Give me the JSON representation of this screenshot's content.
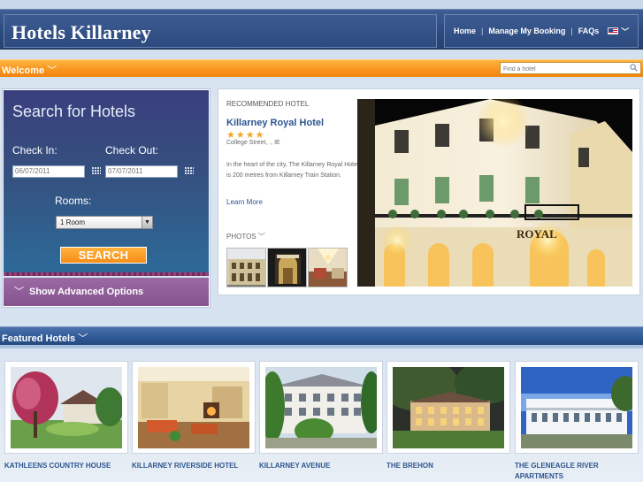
{
  "header": {
    "brand": "Hotels Killarney",
    "nav": [
      {
        "label": "Home"
      },
      {
        "label": "Manage My Booking"
      },
      {
        "label": "FAQs"
      }
    ]
  },
  "welcome_bar": {
    "label": "Welcome",
    "search_placeholder": "Find a hotel"
  },
  "search": {
    "title": "Search for Hotels",
    "checkin_label": "Check In:",
    "checkin_value": "06/07/2011",
    "checkout_label": "Check Out:",
    "checkout_value": "07/07/2011",
    "rooms_label": "Rooms:",
    "rooms_value": "1 Room",
    "button": "SEARCH",
    "advanced": "Show Advanced Options"
  },
  "recommended": {
    "kicker": "RECOMMENDED HOTEL",
    "name": "Killarney Royal Hotel",
    "stars": "★★★★",
    "rating": 4,
    "address": "College Street, ., IE",
    "description": "In the heart of the city, The Killarney Royal Hotel is 200 metres from Killarney Train Station.",
    "more": "Learn More",
    "photos_label": "PHOTOS",
    "sign_text": "ROYAL"
  },
  "featured": {
    "label": "Featured Hotels",
    "hotels": [
      {
        "name": "KATHLEENS COUNTRY HOUSE"
      },
      {
        "name": "KILLARNEY RIVERSIDE HOTEL"
      },
      {
        "name": "KILLARNEY AVENUE"
      },
      {
        "name": "THE BREHON"
      },
      {
        "name": "THE GLENEAGLE RIVER APARTMENTS"
      }
    ]
  },
  "colors": {
    "header_blue": "#2d4a7f",
    "accent_orange": "#f7931e",
    "link_blue": "#2d5690",
    "advanced_purple": "#8a5893",
    "star_gold": "#f5a623"
  }
}
